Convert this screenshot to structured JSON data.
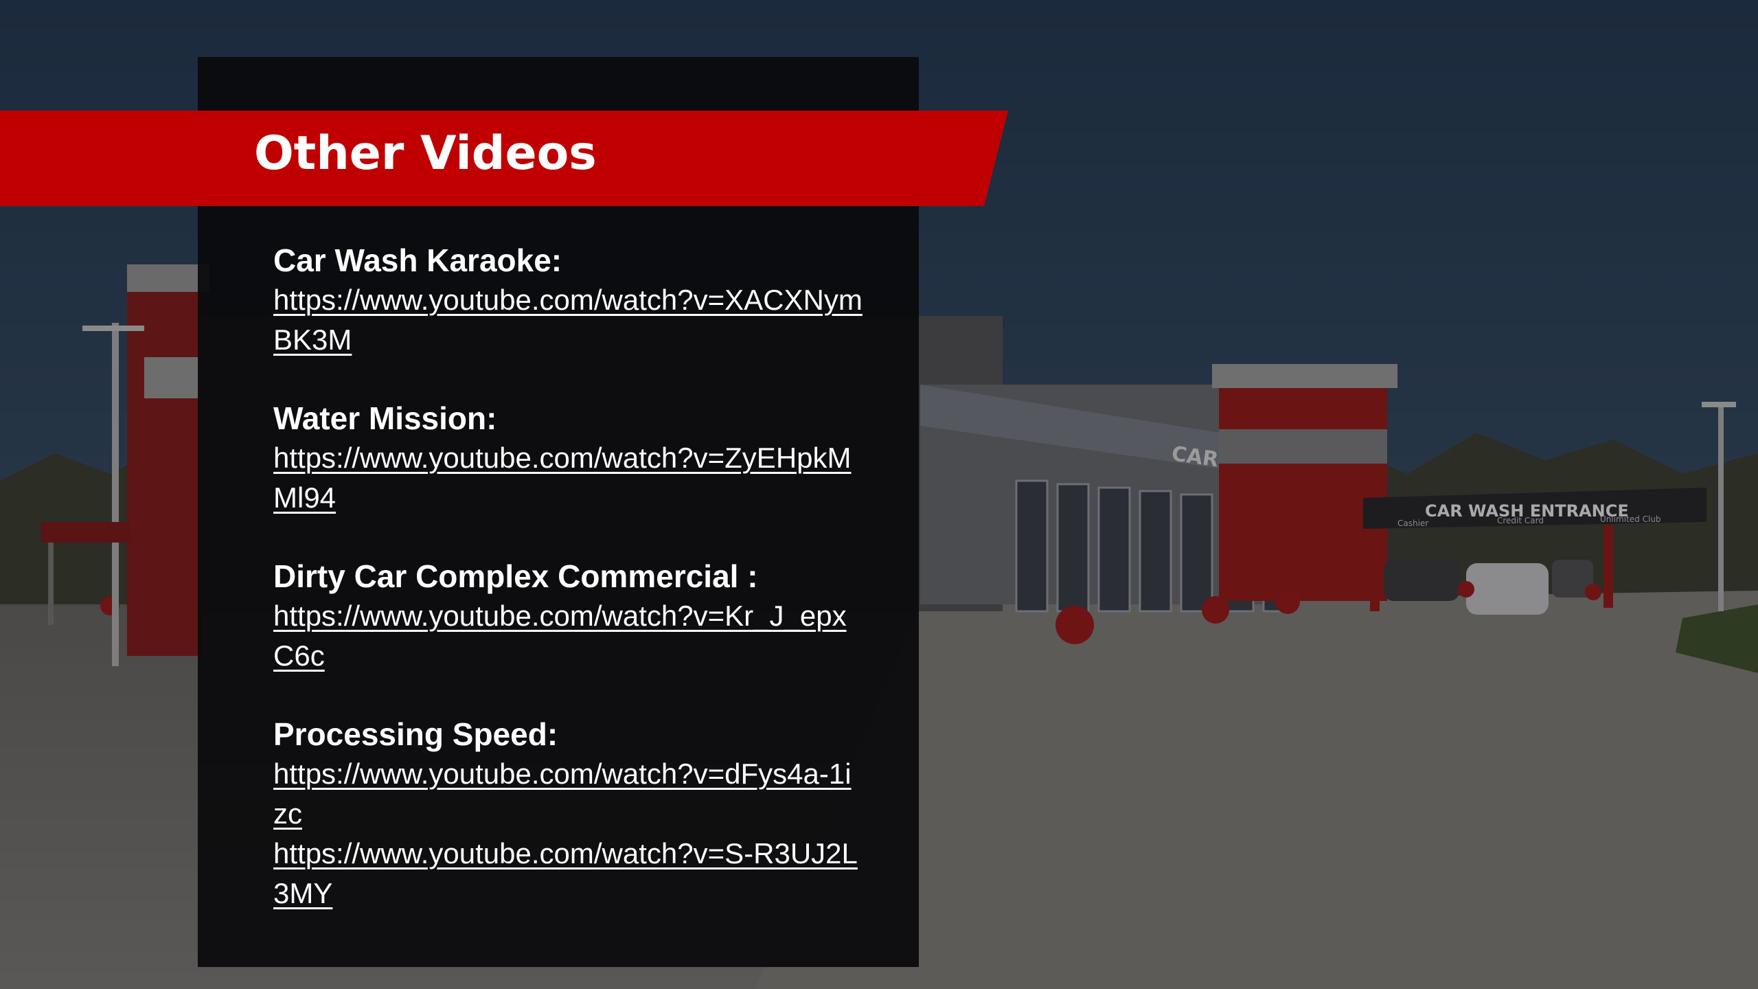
{
  "slide": {
    "title": "Other Videos",
    "colors": {
      "banner": "#c00000",
      "panel": "#0a0a0c",
      "text": "#ffffff"
    },
    "videos": [
      {
        "title": "Car Wash Karaoke:",
        "links": [
          "https://www.youtube.com/watch?v=XACXNymBK3M"
        ]
      },
      {
        "title": "Water Mission:",
        "links": [
          "https://www.youtube.com/watch?v=ZyEHpkMMl94"
        ]
      },
      {
        "title": "Dirty Car Complex Commercial :",
        "links": [
          "https://www.youtube.com/watch?v=Kr_J_epxC6c"
        ]
      },
      {
        "title": "Processing Speed:",
        "links": [
          "https://www.youtube.com/watch?v=dFys4a-1izc",
          "https://www.youtube.com/watch?v=S-R3UJ2L3MY"
        ]
      }
    ],
    "background_labels": {
      "building_sign": "CAR WASH",
      "entrance_sign": "CAR WASH ENTRANCE",
      "lane_cashier": "Cashier",
      "lane_credit": "Credit Card",
      "lane_unlimited": "Unlimited Club"
    }
  }
}
